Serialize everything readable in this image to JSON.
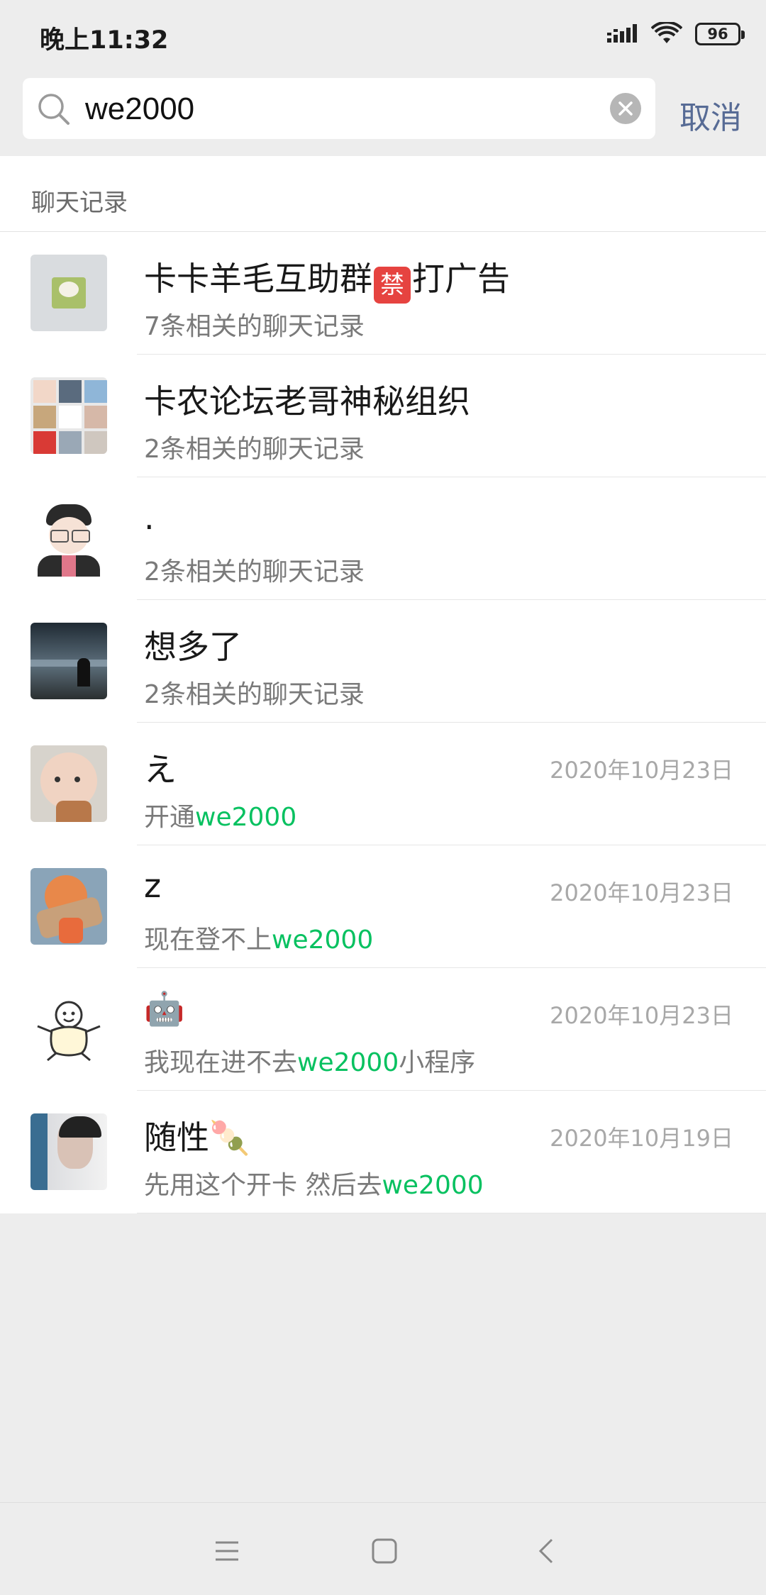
{
  "status_bar": {
    "time": "晚上11:32",
    "battery": "96"
  },
  "search": {
    "query": "we2000",
    "cancel_label": "取消"
  },
  "section": {
    "title": "聊天记录"
  },
  "results": [
    {
      "title_main": "卡卡羊毛互助群",
      "title_badge": "禁",
      "title_tail": "打广告",
      "subtitle": "7条相关的聊天记录",
      "date": ""
    },
    {
      "title_main": "卡农论坛老哥神秘组织",
      "subtitle": "2条相关的聊天记录",
      "date": ""
    },
    {
      "title_main": ".",
      "subtitle": "2条相关的聊天记录",
      "date": ""
    },
    {
      "title_main": "想多了",
      "subtitle": "2条相关的聊天记录",
      "date": ""
    },
    {
      "title_main": "え",
      "sub_pre": "开通",
      "sub_hl": "we2000",
      "sub_post": "",
      "date": "2020年10月23日"
    },
    {
      "title_main": "z",
      "sub_pre": "现在登不上",
      "sub_hl": "we2000",
      "sub_post": "",
      "date": "2020年10月23日"
    },
    {
      "title_main": "🤖",
      "sub_pre": "我现在进不去",
      "sub_hl": "we2000",
      "sub_post": "小程序",
      "date": "2020年10月23日"
    },
    {
      "title_main": "随性",
      "title_emoji": "🍡",
      "sub_pre": "先用这个开卡 然后去",
      "sub_hl": "we2000",
      "sub_post": "",
      "date": "2020年10月19日"
    }
  ],
  "colors": {
    "accent": "#07c160",
    "link": "#576b95",
    "background": "#ededed"
  },
  "nav": {
    "icons": [
      "menu-icon",
      "home-square-icon",
      "back-chevron-icon"
    ]
  }
}
